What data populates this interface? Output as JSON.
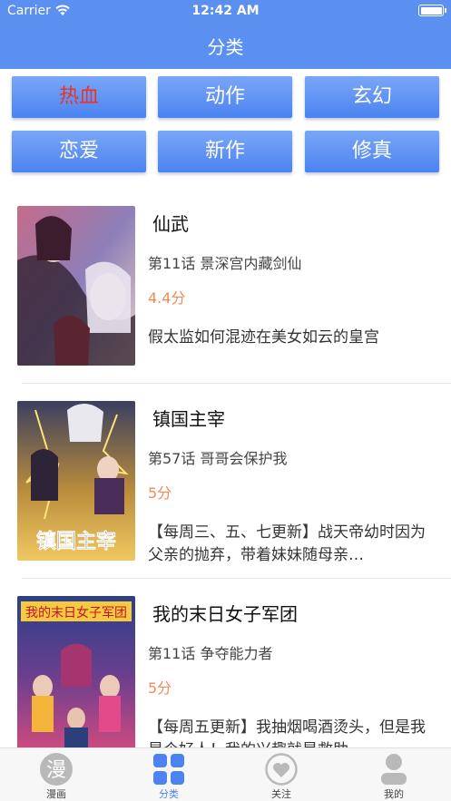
{
  "status_bar": {
    "carrier": "Carrier",
    "time": "12:42 AM"
  },
  "nav": {
    "title": "分类"
  },
  "categories": [
    {
      "label": "热血",
      "active": true
    },
    {
      "label": "动作"
    },
    {
      "label": "玄幻"
    },
    {
      "label": "恋爱"
    },
    {
      "label": "新作"
    },
    {
      "label": "修真"
    }
  ],
  "comics": [
    {
      "title": "仙武",
      "chapter": "第11话 景深宫内藏剑仙",
      "score": "4.4分",
      "desc": "假太监如何混迹在美女如云的皇宫"
    },
    {
      "title": "镇国主宰",
      "chapter": "第57话 哥哥会保护我",
      "score": "5分",
      "desc": "【每周三、五、七更新】战天帝幼时因为父亲的抛弃，带着妹妹随母亲…"
    },
    {
      "title": "我的末日女子军团",
      "chapter": "第11话 争夺能力者",
      "score": "5分",
      "desc": "【每周五更新】我抽烟喝酒烫头，但是我是个好人！我的兴趣就是救助…"
    }
  ],
  "covers": [
    {
      "art_text": ""
    },
    {
      "art_text": "镇国主宰"
    },
    {
      "art_text": "我的末日女子军团"
    }
  ],
  "tabbar": {
    "items": [
      {
        "label": "漫画",
        "icon": "manhua-badge-icon",
        "glyph": "漫"
      },
      {
        "label": "分类",
        "icon": "grid-icon",
        "active": true
      },
      {
        "label": "关注",
        "icon": "heart-icon"
      },
      {
        "label": "我的",
        "icon": "person-icon"
      }
    ]
  },
  "colors": {
    "accent": "#4b83f0",
    "nav_bg": "#5b8ff0",
    "active_category_text": "#e8332c",
    "score": "#ef8a5a"
  }
}
